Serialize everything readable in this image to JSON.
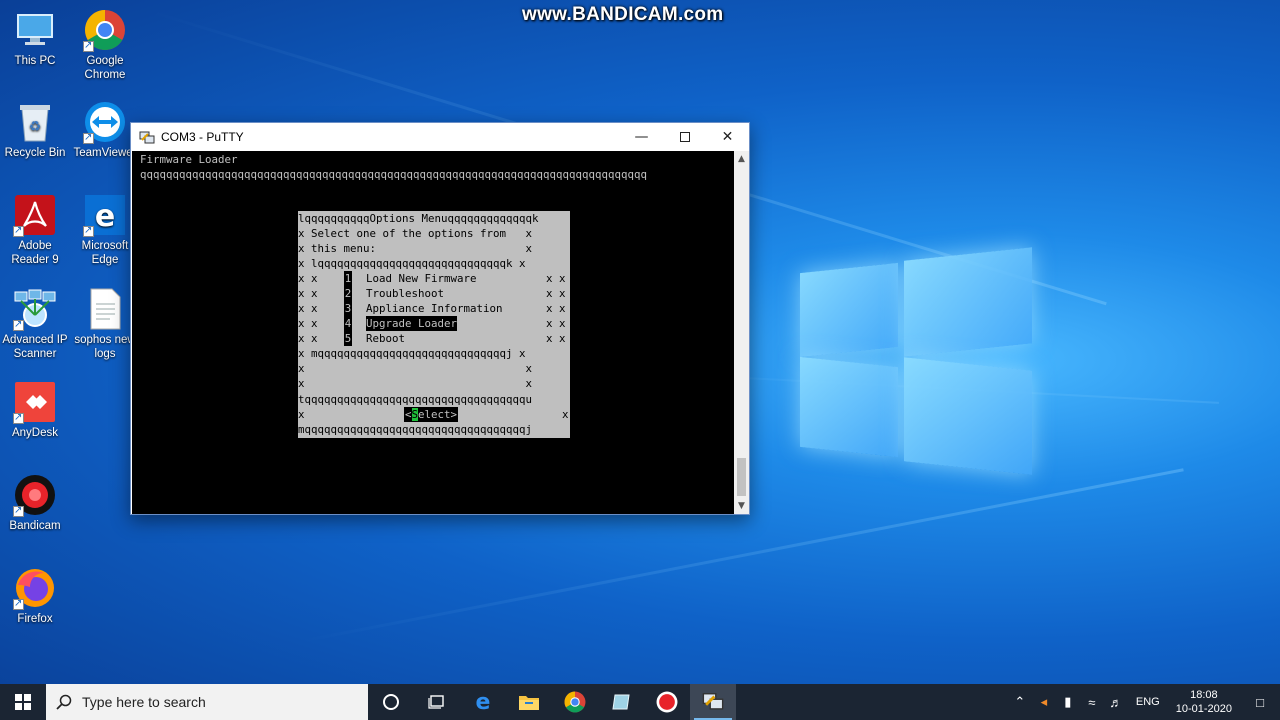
{
  "watermark": "www.BANDICAM.com",
  "desktop_icons": [
    {
      "label": "This PC",
      "icon": "monitor-icon"
    },
    {
      "label": "Google Chrome",
      "icon": "chrome-icon"
    },
    {
      "label": "Recycle Bin",
      "icon": "recycle-bin-icon"
    },
    {
      "label": "TeamViewer",
      "icon": "teamviewer-icon"
    },
    {
      "label": "Adobe Reader 9",
      "icon": "adobe-reader-icon"
    },
    {
      "label": "Microsoft Edge",
      "icon": "edge-icon"
    },
    {
      "label": "Advanced IP Scanner",
      "icon": "ip-scanner-icon"
    },
    {
      "label": "sophos new logs",
      "icon": "document-icon"
    },
    {
      "label": "AnyDesk",
      "icon": "anydesk-icon"
    },
    {
      "label": "Bandicam",
      "icon": "bandicam-icon"
    },
    {
      "label": "Firefox",
      "icon": "firefox-icon"
    }
  ],
  "putty": {
    "title": "COM3 - PuTTY",
    "header": "Firmware Loader",
    "rule": "qqqqqqqqqqqqqqqqqqqqqqqqqqqqqqqqqqqqqqqqqqqqqqqqqqqqqqqqqqqqqqqqqqqqqqqqqqqqqq",
    "dialog": {
      "top": "lqqqqqqqqqqOptions Menuqqqqqqqqqqqqqk",
      "line1": "x Select one of the options from   x",
      "line2": "x this menu:                       x",
      "inner_top": "x lqqqqqqqqqqqqqqqqqqqqqqqqqqqqqk x",
      "row_prefix": "x x",
      "row_suffix": "x x",
      "inner_bottom": "x mqqqqqqqqqqqqqqqqqqqqqqqqqqqqqj x",
      "blank": "x                                  x",
      "sep": "tqqqqqqqqqqqqqqqqqqqqqqqqqqqqqqqqqqu",
      "btn_left": "x",
      "btn_right": "x",
      "bottom": "mqqqqqqqqqqqqqqqqqqqqqqqqqqqqqqqqqqj",
      "options": [
        {
          "num": "1",
          "label": "Load New Firmware"
        },
        {
          "num": "2",
          "label": "Troubleshoot"
        },
        {
          "num": "3",
          "label": "Appliance Information"
        },
        {
          "num": "4",
          "label": "Upgrade Loader"
        },
        {
          "num": "5",
          "label": "Reboot"
        }
      ],
      "selected_index": 3,
      "select_button": {
        "open": "<",
        "hot": "S",
        "rest": "elect>"
      }
    }
  },
  "taskbar": {
    "search_placeholder": "Type here to search",
    "language": "ENG",
    "time": "18:08",
    "date": "10-01-2020"
  }
}
